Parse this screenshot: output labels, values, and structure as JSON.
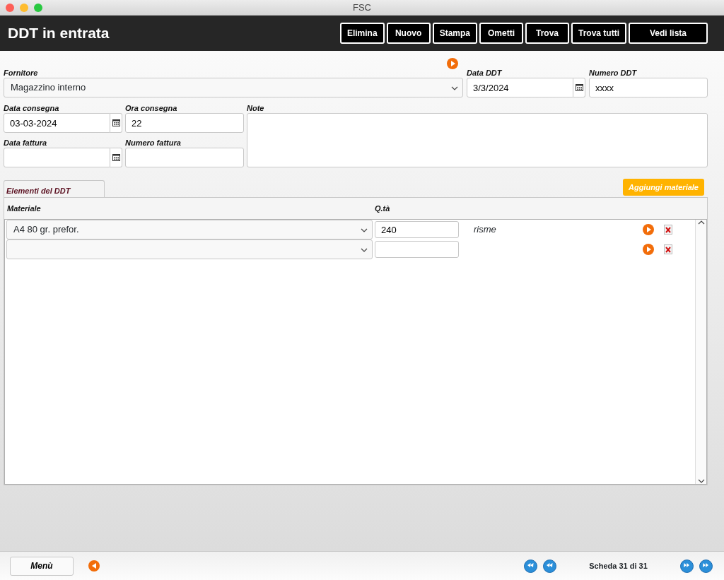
{
  "window": {
    "title": "FSC"
  },
  "header": {
    "title": "DDT in entrata",
    "buttons": [
      "Elimina",
      "Nuovo",
      "Stampa",
      "Ometti",
      "Trova",
      "Trova tutti",
      "Vedi lista"
    ]
  },
  "form": {
    "row_1": [
      {
        "kind": "select",
        "label": "Fornitore",
        "value": "Magazzino interno"
      },
      {
        "kind": "date",
        "label": "Data DDT",
        "value": "3/3/2024"
      },
      {
        "kind": "text",
        "label": "Numero DDT",
        "value": "xxxx"
      }
    ],
    "left_fields": [
      {
        "kind": "date",
        "label": "Data consegna",
        "value": "03-03-2024"
      },
      {
        "kind": "text",
        "label": "Ora consegna",
        "value": "22"
      },
      {
        "kind": "date",
        "label": "Data fattura"
      },
      {
        "kind": "text",
        "label": "Numero fattura"
      }
    ],
    "note": {
      "kind": "textarea",
      "label": "Note"
    }
  },
  "items_panel": {
    "tab": "Elementi del DDT",
    "add_button": "Aggiungi materiale",
    "columns": [
      "Materiale",
      "Q.tà"
    ],
    "rows": [
      {
        "material": "A4 80 gr. prefor.",
        "quantity": "240",
        "unit": "risme"
      },
      {
        "material": "",
        "quantity": "",
        "unit": ""
      }
    ]
  },
  "footer": {
    "menu_button": "Menù",
    "record": "Scheda 31 di 31"
  }
}
